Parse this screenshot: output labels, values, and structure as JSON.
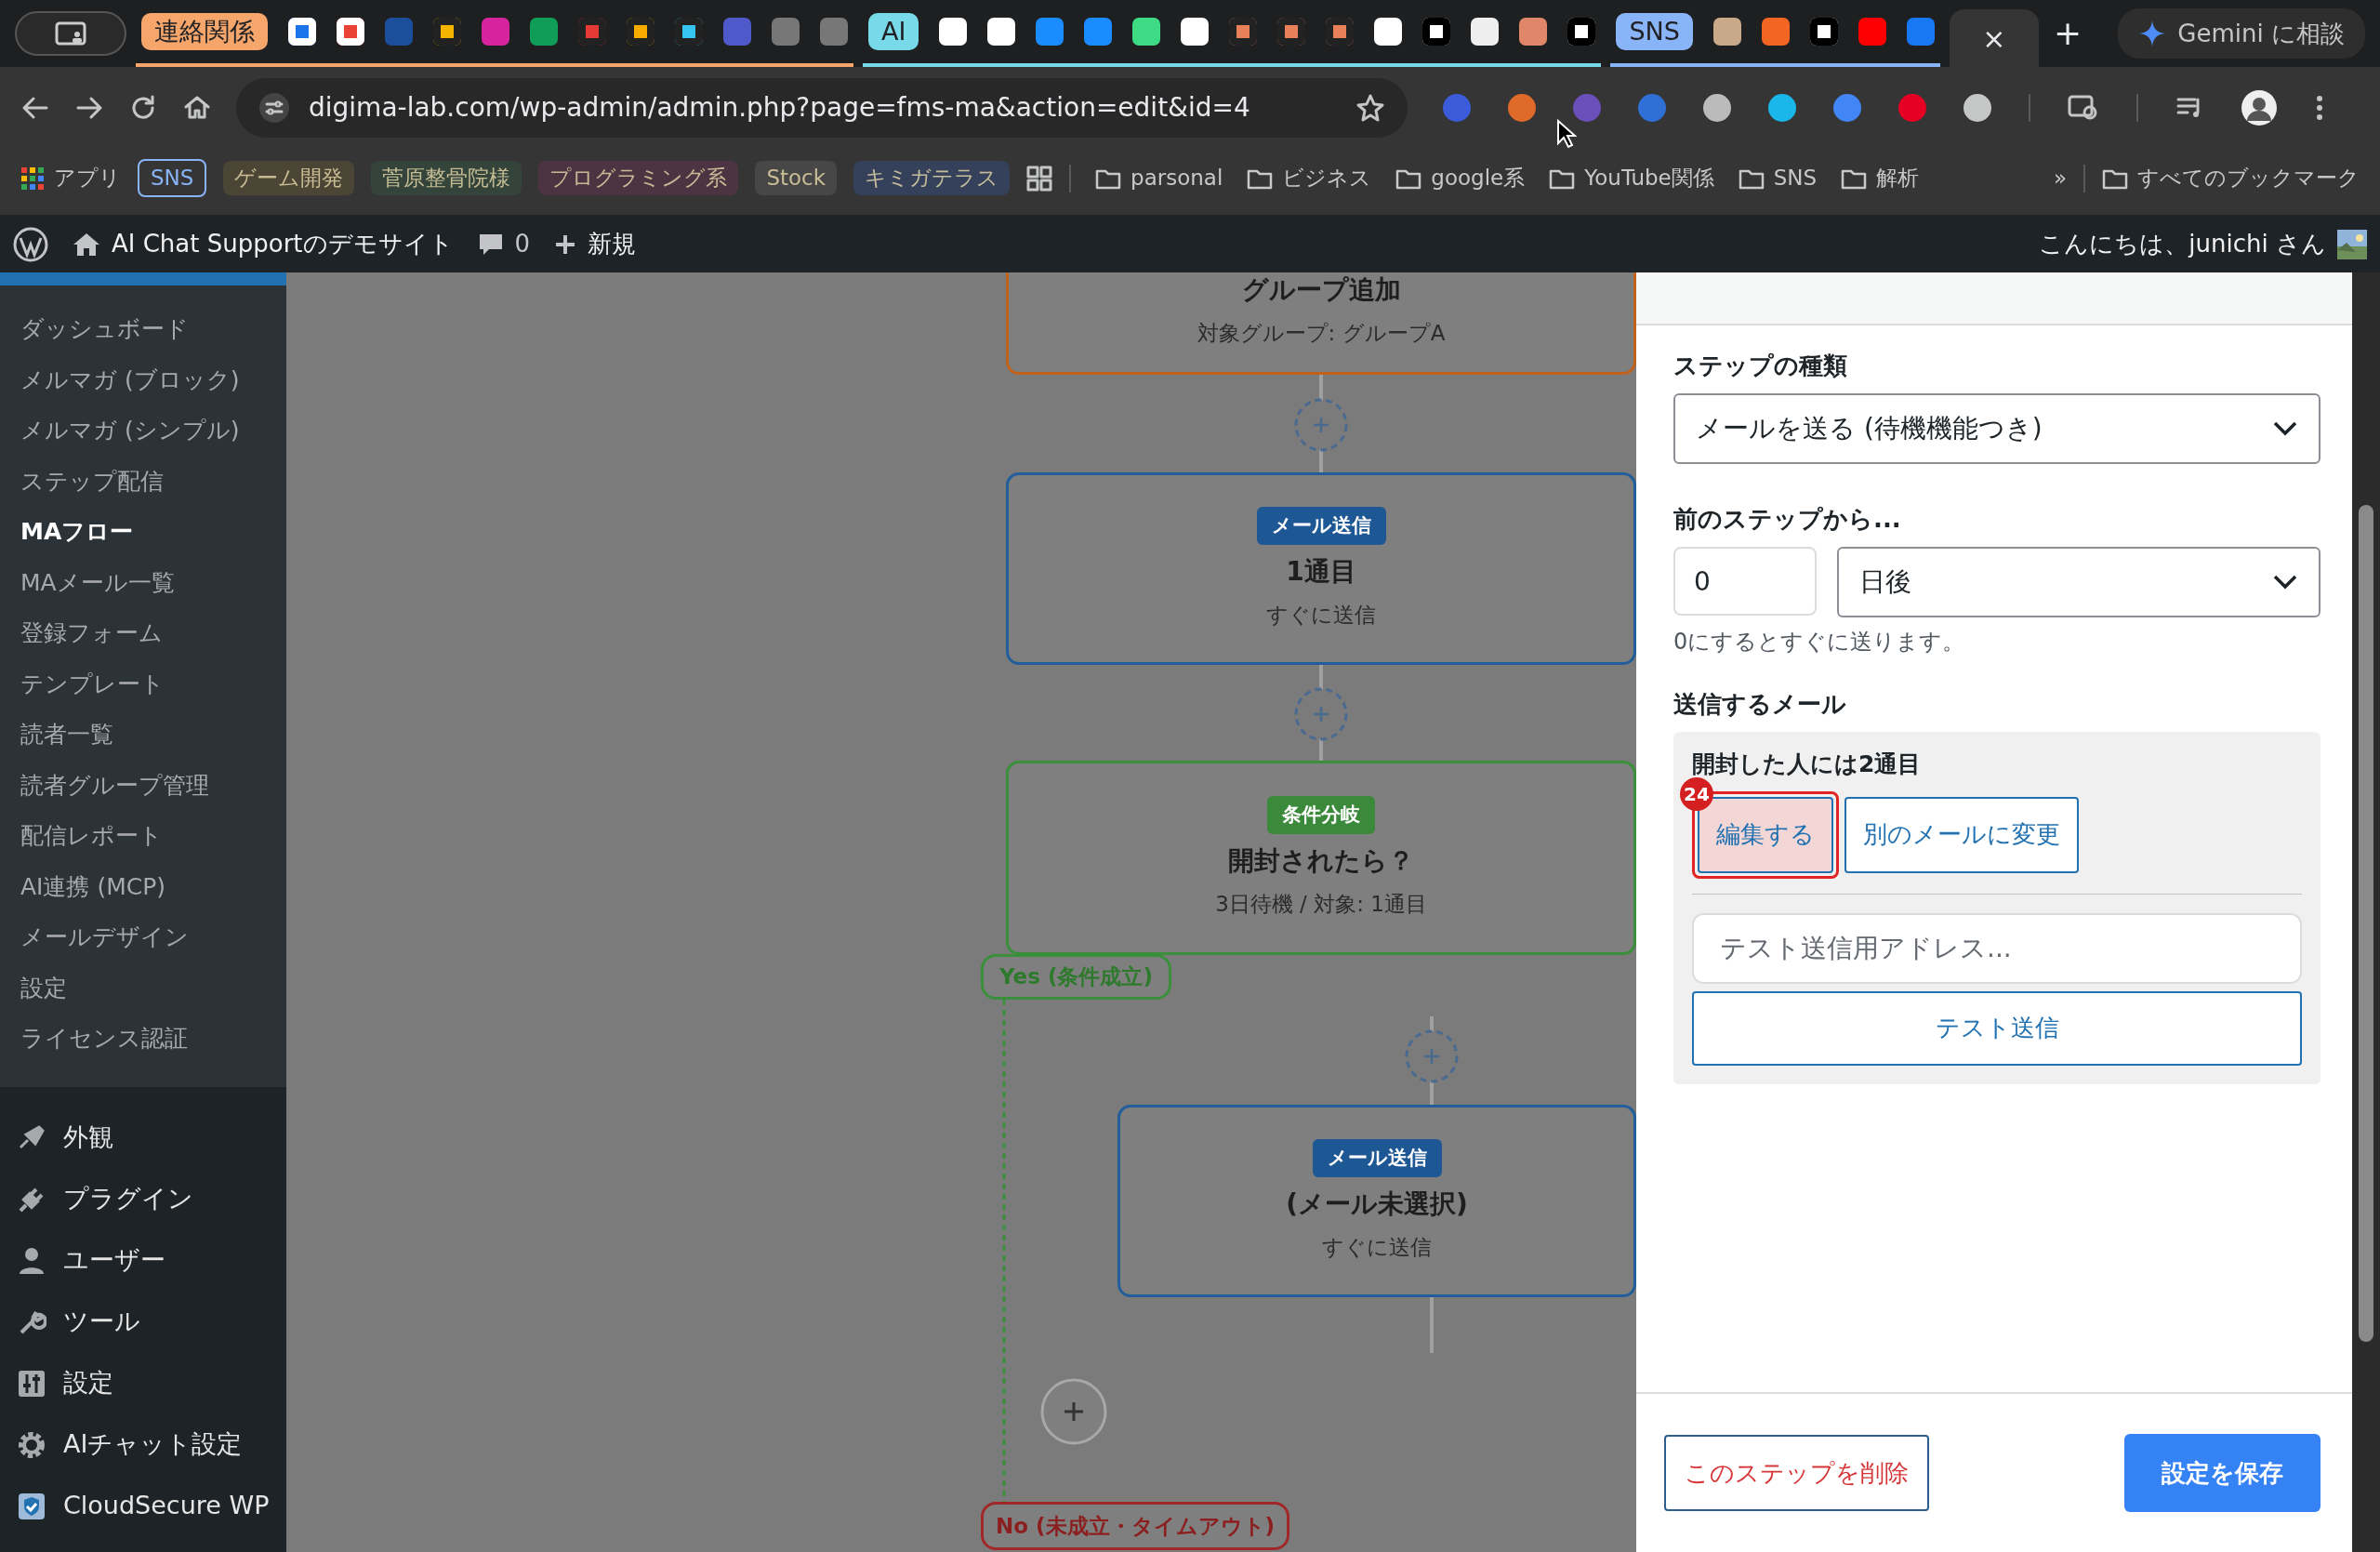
{
  "browser": {
    "tab_groups": [
      {
        "label": "連絡関係",
        "color": "#f6a66b"
      },
      {
        "label": "AI",
        "color": "#78d9e8"
      },
      {
        "label": "SNS",
        "color": "#8ab4f8"
      }
    ],
    "active_tab": {
      "close": "×"
    },
    "new_tab": "+",
    "gemini_button": "Gemini に相談",
    "url": "digima-lab.com/wp-admin/admin.php?page=fms-ma&action=edit&id=4",
    "apps": "アプリ",
    "bookmark_groups": [
      {
        "label": "SNS",
        "color": "#8ab4f8",
        "kind": "outlined"
      },
      {
        "label": "ゲーム開発",
        "color": "#4b4536",
        "kind": "filled"
      },
      {
        "label": "菅原整骨院様",
        "color": "#34443a",
        "kind": "filled"
      },
      {
        "label": "プログラミング系",
        "color": "#4d3442",
        "kind": "filled"
      },
      {
        "label": "Stock",
        "color": "#474747",
        "kind": "filled"
      },
      {
        "label": "キミガテラス",
        "color": "#35405a",
        "kind": "filled"
      }
    ],
    "bookmark_folders": [
      "parsonal",
      "ビジネス",
      "google系",
      "YouTube関係",
      "SNS",
      "解析"
    ],
    "overflow": "»",
    "all_bookmarks": "すべてのブックマーク"
  },
  "admin_bar": {
    "site": "AI Chat Supportのデモサイト",
    "comments": "0",
    "new": "新規",
    "greeting": "こんにちは、junichi さん"
  },
  "sidebar": {
    "submenu": [
      {
        "label": "ダッシュボード",
        "selected": false
      },
      {
        "label": "メルマガ (ブロック)",
        "selected": false
      },
      {
        "label": "メルマガ (シンプル)",
        "selected": false
      },
      {
        "label": "ステップ配信",
        "selected": false
      },
      {
        "label": "MAフロー",
        "selected": true
      },
      {
        "label": "MAメール一覧",
        "selected": false
      },
      {
        "label": "登録フォーム",
        "selected": false
      },
      {
        "label": "テンプレート",
        "selected": false
      },
      {
        "label": "読者一覧",
        "selected": false
      },
      {
        "label": "読者グループ管理",
        "selected": false
      },
      {
        "label": "配信レポート",
        "selected": false
      },
      {
        "label": "AI連携 (MCP)",
        "selected": false
      },
      {
        "label": "メールデザイン",
        "selected": false
      },
      {
        "label": "設定",
        "selected": false
      },
      {
        "label": "ライセンス認証",
        "selected": false
      }
    ],
    "menu": [
      "外観",
      "プラグイン",
      "ユーザー",
      "ツール",
      "設定",
      "AIチャット設定",
      "CloudSecure WP"
    ]
  },
  "flow": {
    "nodes": [
      {
        "kind": "group",
        "title": "グループ追加",
        "detail": "対象グループ: グループA"
      },
      {
        "kind": "mail",
        "badge": "メール送信",
        "title": "1通目",
        "detail": "すぐに送信"
      },
      {
        "kind": "branch",
        "badge": "条件分岐",
        "title": "開封されたら？",
        "detail": "3日待機 / 対象: 1通目"
      },
      {
        "kind": "mail",
        "badge": "メール送信",
        "title": "(メール未選択)",
        "detail": "すぐに送信"
      }
    ],
    "branches": [
      {
        "kind": "yes",
        "label": "Yes (条件成立)"
      },
      {
        "kind": "no",
        "label": "No (未成立・タイムアウト)"
      }
    ]
  },
  "panel": {
    "step_type": {
      "label": "ステップの種類",
      "value": "メールを送る (待機機能つき)"
    },
    "delay": {
      "label": "前のステップから...",
      "value": "0",
      "unit": "日後",
      "help": "0にするとすぐに送ります。"
    },
    "mail": {
      "label": "送信するメール",
      "name": "開封した人には2通目",
      "buttons": [
        {
          "label": "編集する",
          "highlighted": true
        },
        {
          "label": "別のメールに変更",
          "highlighted": false
        }
      ],
      "annotation": "24",
      "test_placeholder": "テスト送信用アドレス...",
      "test_button": "テスト送信"
    },
    "delete_button": "このステップを削除",
    "save_button": "設定を保存"
  }
}
